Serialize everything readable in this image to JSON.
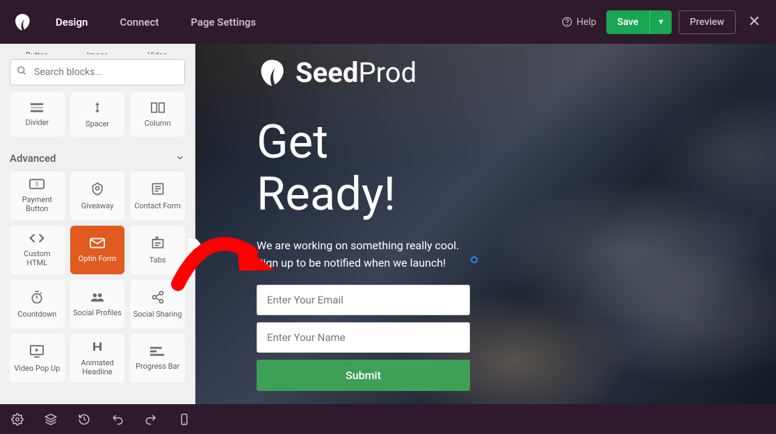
{
  "nav": {
    "design": "Design",
    "connect": "Connect",
    "page_settings": "Page Settings",
    "help": "Help",
    "save": "Save",
    "preview": "Preview"
  },
  "sidebar": {
    "top_partial": [
      "Button",
      "Image",
      "Video"
    ],
    "search_placeholder": "Search blocks...",
    "basic": {
      "divider": "Divider",
      "spacer": "Spacer",
      "column": "Column"
    },
    "section_advanced": "Advanced",
    "advanced": {
      "payment": "Payment Button",
      "giveaway": "Giveaway",
      "contact": "Contact Form",
      "custom_html": "Custom HTML",
      "optin": "Optin Form",
      "tabs": "Tabs",
      "countdown": "Countdown",
      "social_profiles": "Social Profiles",
      "social_sharing": "Social Sharing",
      "video_popup": "Video Pop Up",
      "animated_headline": "Animated Headline",
      "progress_bar": "Progress Bar"
    }
  },
  "canvas": {
    "brand_bold": "Seed",
    "brand_light": "Prod",
    "headline_l1": "Get",
    "headline_l2": "Ready!",
    "sub_l1": "We are working on something really cool.",
    "sub_l2": "Sign up to be notified when we launch!",
    "email_ph": "Enter Your Email",
    "name_ph": "Enter Your Name",
    "submit": "Submit"
  }
}
